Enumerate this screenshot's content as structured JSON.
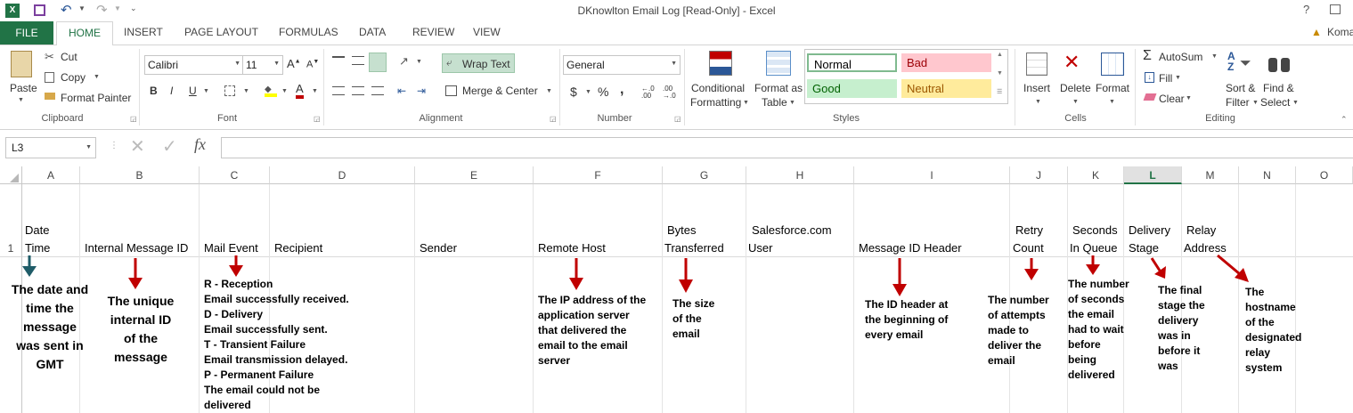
{
  "window": {
    "title": "DKnowlton Email Log  [Read-Only] - Excel"
  },
  "tabs": [
    "FILE",
    "HOME",
    "INSERT",
    "PAGE LAYOUT",
    "FORMULAS",
    "DATA",
    "REVIEW",
    "VIEW"
  ],
  "account": "Koma",
  "ribbon": {
    "clipboard": {
      "paste": "Paste",
      "cut": "Cut",
      "copy": "Copy",
      "format_painter": "Format Painter",
      "label": "Clipboard"
    },
    "font": {
      "name": "Calibri",
      "size": "11",
      "label": "Font",
      "bold": "B",
      "italic": "I",
      "underline": "U"
    },
    "alignment": {
      "wrap_text": "Wrap Text",
      "merge_center": "Merge & Center",
      "label": "Alignment"
    },
    "number": {
      "format": "General",
      "label": "Number",
      "currency": "$",
      "percent": "%",
      "comma": ","
    },
    "styles": {
      "conditional": [
        "Conditional",
        "Formatting"
      ],
      "format_table": [
        "Format as",
        "Table"
      ],
      "normal": "Normal",
      "bad": "Bad",
      "good": "Good",
      "neutral": "Neutral",
      "label": "Styles",
      "colors": {
        "normal_border": "#7fba8f",
        "bad_bg": "#ffc7ce",
        "bad_fg": "#9c0006",
        "good_bg": "#c6efce",
        "good_fg": "#006100",
        "neutral_bg": "#ffeb9c",
        "neutral_fg": "#9c5700"
      }
    },
    "cells": {
      "insert": "Insert",
      "delete": "Delete",
      "format": "Format",
      "label": "Cells"
    },
    "editing": {
      "autosum": "AutoSum",
      "fill": "Fill",
      "clear": "Clear",
      "sort_filter": [
        "Sort &",
        "Filter"
      ],
      "find_select": [
        "Find &",
        "Select"
      ],
      "label": "Editing"
    }
  },
  "formula_bar": {
    "name_box": "L3",
    "formula": "",
    "fx": "fx"
  },
  "columns": [
    "A",
    "B",
    "C",
    "D",
    "E",
    "F",
    "G",
    "H",
    "I",
    "J",
    "K",
    "L",
    "M",
    "N",
    "O"
  ],
  "selected_column": "L",
  "row_numbers": [
    "1"
  ],
  "header_row": [
    [
      "Date",
      "Time"
    ],
    [
      "Internal Message ID"
    ],
    [
      "Mail Event"
    ],
    [
      "Recipient"
    ],
    [
      "Sender"
    ],
    [
      "Remote Host"
    ],
    [
      "Bytes",
      "Transferred"
    ],
    [
      "Salesforce.com",
      "User"
    ],
    [
      "Message ID Header"
    ],
    [
      "Retry",
      "Count"
    ],
    [
      "Seconds",
      "In Queue"
    ],
    [
      "Delivery",
      "Stage"
    ],
    [
      "Relay",
      "Address"
    ]
  ],
  "annotations": {
    "date_time": [
      "The date and",
      "time the",
      "message",
      "was sent in",
      "GMT"
    ],
    "internal_id": [
      "The unique",
      "internal ID",
      "of the",
      "message"
    ],
    "mail_event": [
      "R - Reception",
      "Email successfully received.",
      "D - Delivery",
      "Email  successfully sent.",
      "T - Transient Failure",
      "Email transmission delayed.",
      "P - Permanent Failure",
      "The email could not be",
      "delivered"
    ],
    "remote_host": [
      "The IP address of the",
      "application server",
      "that delivered the",
      "email to the email",
      "server"
    ],
    "bytes": [
      "The size",
      "of the",
      "email"
    ],
    "message_id": [
      "The ID header at",
      "the beginning of",
      "every email"
    ],
    "retry": [
      "The number",
      "of attempts",
      "made to",
      "deliver the",
      "email"
    ],
    "seconds": [
      "The number",
      "of seconds",
      "the email",
      "had to wait",
      "before",
      "being",
      "delivered"
    ],
    "stage": [
      "The final",
      "stage the",
      "delivery",
      "was in",
      "before it",
      "was"
    ],
    "relay": [
      "The",
      "hostname",
      "of the",
      "designated",
      "relay",
      "system"
    ]
  },
  "arrow_colors": {
    "red": "#c00000",
    "teal": "#1f5c68"
  }
}
